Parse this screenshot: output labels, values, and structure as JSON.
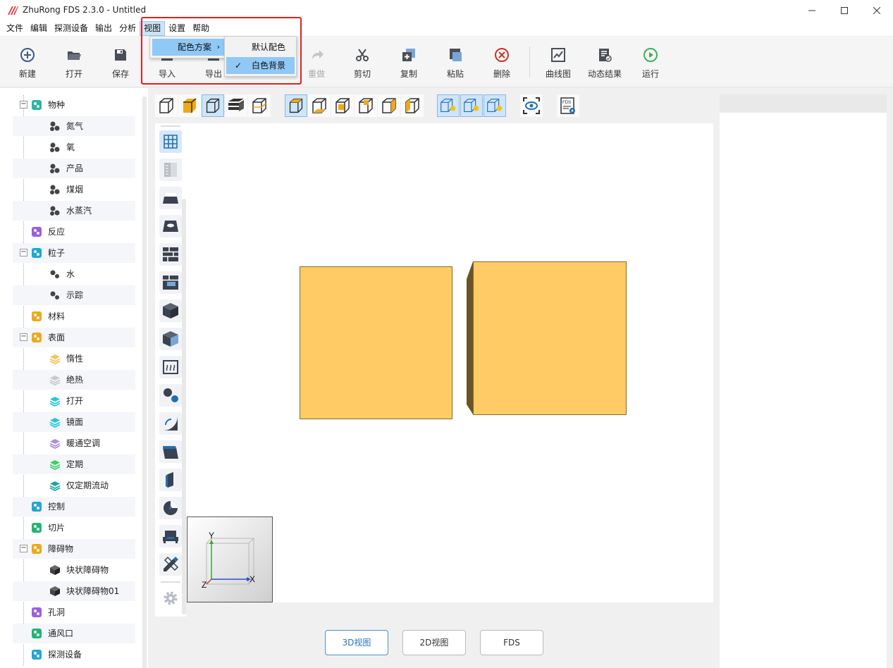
{
  "window": {
    "title": "ZhuRong FDS 2.3.0 - Untitled",
    "accent": "#d63a3a"
  },
  "menubar": {
    "items": [
      "文件",
      "编辑",
      "探测设备",
      "输出",
      "分析",
      "视图",
      "设置",
      "帮助"
    ],
    "active": "视图"
  },
  "toolbar": {
    "buttons": [
      {
        "label": "新建",
        "icon": "plus-circle-icon"
      },
      {
        "label": "打开",
        "icon": "folder-icon"
      },
      {
        "label": "保存",
        "icon": "save-icon"
      },
      {
        "label": "导入",
        "icon": "import-icon"
      },
      {
        "label": "导出",
        "icon": "export-icon"
      },
      {
        "label": "重做",
        "icon": "redo-icon"
      },
      {
        "label": "剪切",
        "icon": "scissors-icon"
      },
      {
        "label": "复制",
        "icon": "copy-icon"
      },
      {
        "label": "粘贴",
        "icon": "paste-icon"
      },
      {
        "label": "删除",
        "icon": "delete-icon"
      },
      {
        "label": "曲线图",
        "icon": "line-chart-icon"
      },
      {
        "label": "动态结果",
        "icon": "dynamic-result-icon"
      },
      {
        "label": "运行",
        "icon": "play-icon"
      }
    ]
  },
  "view_menu": {
    "item": "配色方案",
    "submenu": [
      {
        "label": "默认配色",
        "checked": false
      },
      {
        "label": "白色背景",
        "checked": true
      }
    ]
  },
  "tree": {
    "items": [
      {
        "label": "物种",
        "level": 0,
        "expander": "−",
        "icon": "species-icon",
        "color": "#2bb5a5"
      },
      {
        "label": "氮气",
        "level": 1,
        "icon": "molecule-icon",
        "color": "#444"
      },
      {
        "label": "氧",
        "level": 1,
        "icon": "molecule-icon",
        "color": "#444"
      },
      {
        "label": "产品",
        "level": 1,
        "icon": "molecule-icon",
        "color": "#444"
      },
      {
        "label": "煤烟",
        "level": 1,
        "icon": "molecule-icon",
        "color": "#444"
      },
      {
        "label": "水蒸汽",
        "level": 1,
        "icon": "molecule-icon",
        "color": "#444"
      },
      {
        "label": "反应",
        "level": 0,
        "icon": "reaction-icon",
        "color": "#9b5de5"
      },
      {
        "label": "粒子",
        "level": 0,
        "expander": "−",
        "icon": "particle-icon",
        "color": "#1fa7d6"
      },
      {
        "label": "水",
        "level": 1,
        "icon": "particle-dot-icon",
        "color": "#444"
      },
      {
        "label": "示踪",
        "level": 1,
        "icon": "particle-dot-icon",
        "color": "#444"
      },
      {
        "label": "材料",
        "level": 0,
        "icon": "material-icon",
        "color": "#f0a81a"
      },
      {
        "label": "表面",
        "level": 0,
        "expander": "−",
        "icon": "surface-icon",
        "color": "#f0a81a"
      },
      {
        "label": "惰性",
        "level": 1,
        "icon": "layers-icon",
        "color": "#f7c35f"
      },
      {
        "label": "绝热",
        "level": 1,
        "icon": "layers-icon",
        "color": "#c9c9c9"
      },
      {
        "label": "打开",
        "level": 1,
        "icon": "layers-icon",
        "color": "#22c8e0"
      },
      {
        "label": "镜面",
        "level": 1,
        "icon": "layers-icon",
        "color": "#22c8e0"
      },
      {
        "label": "暖通空调",
        "level": 1,
        "icon": "layers-icon",
        "color": "#a98fd8"
      },
      {
        "label": "定期",
        "level": 1,
        "icon": "layers-icon",
        "color": "#3ccf6a"
      },
      {
        "label": "仅定期流动",
        "level": 1,
        "icon": "layers-icon",
        "color": "#19a7a0"
      },
      {
        "label": "控制",
        "level": 0,
        "icon": "control-icon",
        "color": "#1fa7d6"
      },
      {
        "label": "切片",
        "level": 0,
        "icon": "slice-icon",
        "color": "#22b573"
      },
      {
        "label": "障碍物",
        "level": 0,
        "expander": "−",
        "icon": "obstruction-icon",
        "color": "#f0a81a"
      },
      {
        "label": "块状障碍物",
        "level": 1,
        "icon": "cube-icon",
        "color": "#444"
      },
      {
        "label": "块状障碍物01",
        "level": 1,
        "icon": "cube-icon",
        "color": "#444"
      },
      {
        "label": "孔洞",
        "level": 0,
        "icon": "hole-icon",
        "color": "#9b5de5"
      },
      {
        "label": "通风口",
        "level": 0,
        "icon": "vent-icon",
        "color": "#22b573"
      },
      {
        "label": "探测设备",
        "level": 0,
        "icon": "device-icon",
        "color": "#1fa7d6"
      }
    ]
  },
  "view_tabs": [
    "3D视图",
    "2D视图",
    "FDS"
  ],
  "active_tab": "3D视图",
  "axes": {
    "x": "X",
    "y": "Y",
    "z": "Z"
  },
  "box_color": "#fecb64"
}
